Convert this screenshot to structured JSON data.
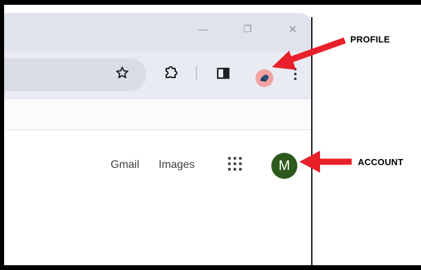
{
  "window": {
    "minimize_glyph": "—",
    "restore_glyph": "❐",
    "close_glyph": "✕"
  },
  "toolbar": {
    "bookmark_icon": "star-icon",
    "extensions_icon": "puzzle-icon",
    "side_panel_icon": "side-panel-icon",
    "menu_icon": "kebab-menu-icon",
    "profile_icon": "profile-avatar"
  },
  "google_nav": {
    "gmail_label": "Gmail",
    "images_label": "Images",
    "apps_icon": "apps-grid-icon",
    "account_initial": "M",
    "account_color": "#2d5a1c"
  },
  "annotations": {
    "profile_label": "PROFILE",
    "account_label": "ACCOUNT",
    "arrow_color": "#e8202a"
  }
}
